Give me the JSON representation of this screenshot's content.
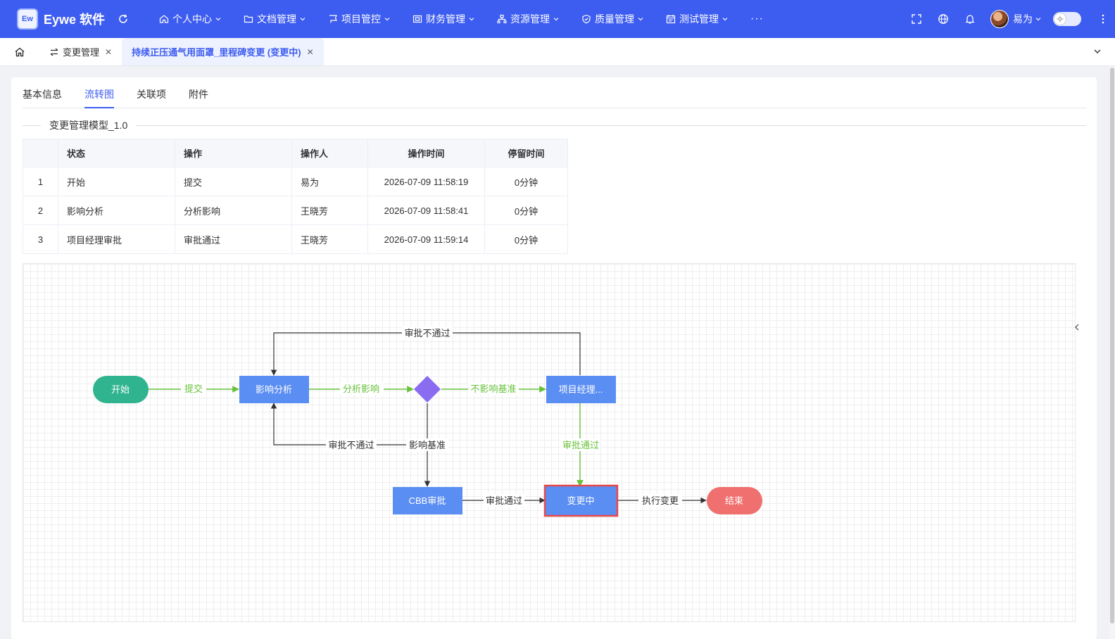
{
  "app": {
    "brand_logo": "Ew",
    "brand_name": "Eywe 软件"
  },
  "nav": [
    {
      "label": "个人中心",
      "icon": "home-icon"
    },
    {
      "label": "文档管理",
      "icon": "folder-icon"
    },
    {
      "label": "项目管控",
      "icon": "flag-icon"
    },
    {
      "label": "财务管理",
      "icon": "finance-icon"
    },
    {
      "label": "资源管理",
      "icon": "resource-icon"
    },
    {
      "label": "质量管理",
      "icon": "shield-icon"
    },
    {
      "label": "测试管理",
      "icon": "calendar-icon"
    }
  ],
  "nav_more": "···",
  "user": {
    "name": "易为"
  },
  "tabs": [
    {
      "label": "变更管理"
    },
    {
      "label": "持续正压通气用面罩_里程碑变更 (变更中)"
    }
  ],
  "subtabs": [
    "基本信息",
    "流转图",
    "关联项",
    "附件"
  ],
  "model_title": "变更管理模型_1.0",
  "history": {
    "headers": [
      "",
      "状态",
      "操作",
      "操作人",
      "操作时间",
      "停留时间"
    ],
    "rows": [
      [
        "1",
        "开始",
        "提交",
        "易为",
        "2026-07-09 11:58:19",
        "0分钟"
      ],
      [
        "2",
        "影响分析",
        "分析影响",
        "王晓芳",
        "2026-07-09 11:58:41",
        "0分钟"
      ],
      [
        "3",
        "项目经理审批",
        "审批通过",
        "王晓芳",
        "2026-07-09 11:59:14",
        "0分钟"
      ]
    ]
  },
  "flow": {
    "nodes": {
      "start": "开始",
      "analysis": "影响分析",
      "pm": "项目经理...",
      "cbb": "CBB审批",
      "changing": "变更中",
      "end": "结束"
    },
    "edges": {
      "submit": "提交",
      "analyze": "分析影响",
      "no_impact": "不影响基准",
      "reject_top": "审批不通过",
      "pm_approve": "审批通过",
      "impact": "影响基准",
      "reject_cbb": "审批不通过",
      "cbb_approve": "审批通过",
      "execute": "执行变更"
    },
    "colors": {
      "start": "#2fb48f",
      "task": "#5b8ef2",
      "gateway": "#8a6cf0",
      "end": "#f07070",
      "active_border": "#e84848",
      "done_edge": "#67c23a",
      "edge": "#333333"
    }
  }
}
